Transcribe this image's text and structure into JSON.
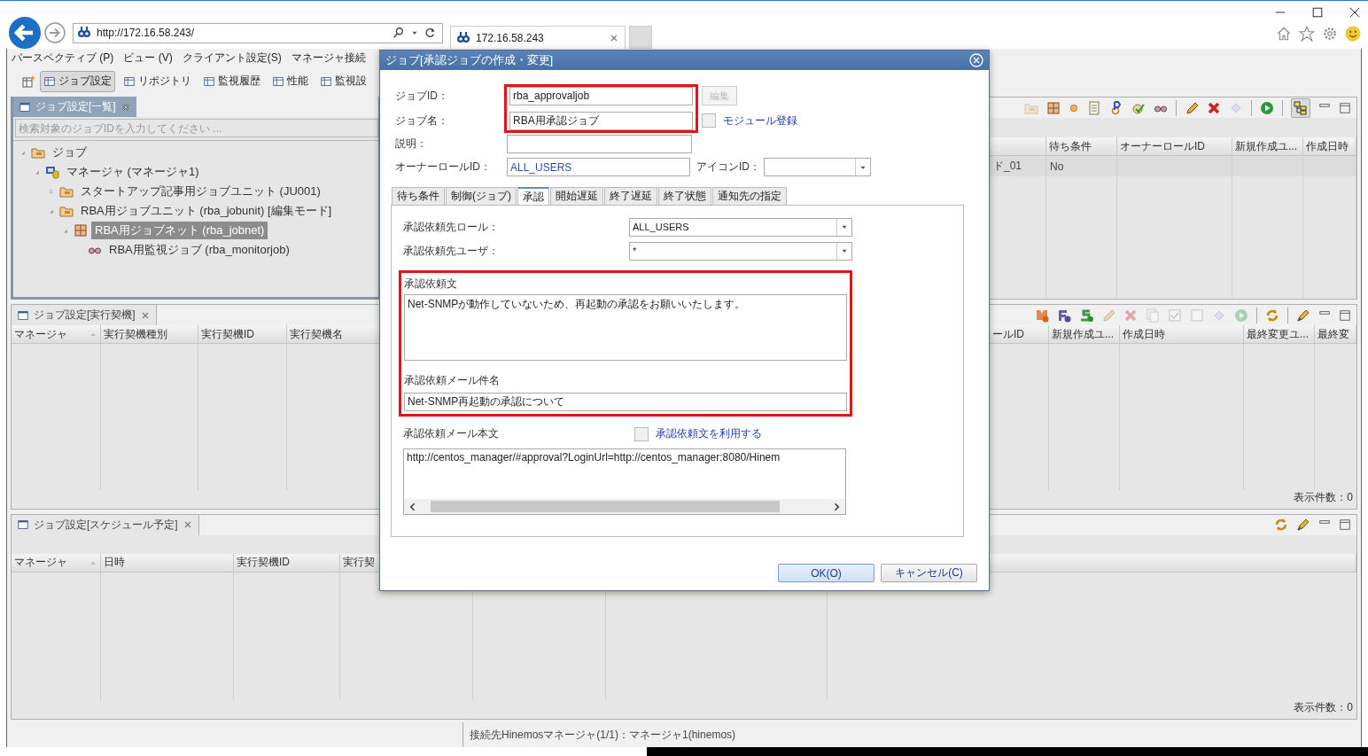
{
  "browser": {
    "address": "http://172.16.58.243/",
    "tabs": [
      {
        "title": "172.16.58.243",
        "selected": true
      }
    ]
  },
  "menu": [
    "パースペクティブ (P)",
    "ビュー (V)",
    "クライアント設定(S)",
    "マネージャ接続"
  ],
  "perspectives": [
    {
      "label": "ジョブ設定",
      "selected": true
    },
    {
      "label": "リポジトリ",
      "selected": false
    },
    {
      "label": "監視履歴",
      "selected": false
    },
    {
      "label": "性能",
      "selected": false
    },
    {
      "label": "監視設",
      "selected": false
    }
  ],
  "job_list_view": {
    "title": "ジョブ設定[一覧]",
    "search": {
      "placeholder": "検索対象のジョブIDを入力してください ..."
    },
    "tree": [
      {
        "label": "ジョブ",
        "kind": "folder",
        "has_children": true,
        "expanded": true,
        "selected": false,
        "children": [
          {
            "label": "マネージャ (マネージャ1)",
            "kind": "manager",
            "has_children": true,
            "expanded": true,
            "selected": false,
            "children": [
              {
                "label": "スタートアップ記事用ジョブユニット (JU001)",
                "kind": "folder",
                "has_children": true,
                "expanded": false,
                "selected": false
              },
              {
                "label": "RBA用ジョブユニット (rba_jobunit) [編集モード]",
                "kind": "folder",
                "has_children": true,
                "expanded": true,
                "selected": false,
                "children": [
                  {
                    "label": "RBA用ジョブネット (rba_jobnet)",
                    "kind": "jobnet",
                    "has_children": true,
                    "expanded": true,
                    "selected": true,
                    "children": [
                      {
                        "label": "RBA用監視ジョブ (rba_monitorjob)",
                        "kind": "monitor",
                        "has_children": false,
                        "selected": false
                      }
                    ]
                  }
                ]
              }
            ]
          }
        ]
      }
    ]
  },
  "job_detail_table": {
    "columns": [
      "待ち条件",
      "オーナーロールID",
      "新規作成ユ...",
      "作成日時"
    ],
    "rows": [
      {
        "column_1": "ド_01",
        "cells": [
          "No"
        ]
      }
    ]
  },
  "trigger_view": {
    "title": "ジョブ設定[実行契機]",
    "left_columns": [
      {
        "label": "マネージャ",
        "sorted": true
      },
      {
        "label": "実行契機種別",
        "sorted": false
      },
      {
        "label": "実行契機ID",
        "sorted": false
      },
      {
        "label": "実行契機名",
        "sorted": false
      }
    ],
    "right_columns": [
      {
        "label": "ールID",
        "sorted": false
      },
      {
        "label": "新規作成ユ...",
        "sorted": false
      },
      {
        "label": "作成日時",
        "sorted": false
      },
      {
        "label": "最終変更ユ...",
        "sorted": false
      },
      {
        "label": "最終変",
        "sorted": false
      }
    ],
    "count": "表示件数：0"
  },
  "schedule_view": {
    "title": "ジョブ設定[スケジュール予定]",
    "columns": [
      {
        "label": "マネージャ",
        "sorted": true
      },
      {
        "label": "日時",
        "sorted": false
      },
      {
        "label": "実行契機ID",
        "sorted": false
      },
      {
        "label": "実行契"
      }
    ],
    "count": "表示件数：0"
  },
  "status_bar": "接続先Hinemosマネージャ(1/1)：マネージャ1(hinemos)",
  "dialog": {
    "title": "ジョブ[承認ジョブの作成・変更]",
    "id_name_highlighted": true,
    "job_id": {
      "label": "ジョブID：",
      "value": "rba_approvaljob"
    },
    "edit_button": {
      "label": "編集",
      "disabled": true
    },
    "job_name": {
      "label": "ジョブ名：",
      "value": "RBA用承認ジョブ"
    },
    "module_register": {
      "label": "モジュール登録",
      "checked": false
    },
    "description": {
      "label": "説明："
    },
    "owner_role": {
      "label": "オーナーロールID：",
      "value": "ALL_USERS"
    },
    "icon_id": {
      "label": "アイコンID："
    },
    "tabs": [
      {
        "label": "待ち条件",
        "selected": false
      },
      {
        "label": "制御(ジョブ)",
        "selected": false
      },
      {
        "label": "承認",
        "selected": true
      },
      {
        "label": "開始遅延",
        "selected": false
      },
      {
        "label": "終了遅延",
        "selected": false
      },
      {
        "label": "終了状態",
        "selected": false
      },
      {
        "label": "通知先の指定",
        "selected": false
      }
    ],
    "approval": {
      "role": {
        "label": "承認依頼先ロール：",
        "value": "ALL_USERS"
      },
      "user": {
        "label": "承認依頼先ユーザ：",
        "value": "*"
      },
      "highlighted": true,
      "request_text": {
        "label": "承認依頼文",
        "value": "Net-SNMPが動作していないため、再起動の承認をお願いいたします。"
      },
      "mail_subject": {
        "label": "承認依頼メール件名",
        "value": "Net-SNMP再起動の承認について"
      },
      "mail_body": {
        "label": "承認依頼メール本文",
        "value": "http://centos_manager/#approval?LoginUrl=http://centos_manager:8080/Hinem"
      },
      "use_request_text": {
        "label": "承認依頼文を利用する",
        "checked": false
      }
    },
    "buttons": [
      {
        "label": "OK(O)",
        "kind": "ok"
      },
      {
        "label": "キャンセル(C)",
        "kind": "cancel"
      }
    ]
  }
}
